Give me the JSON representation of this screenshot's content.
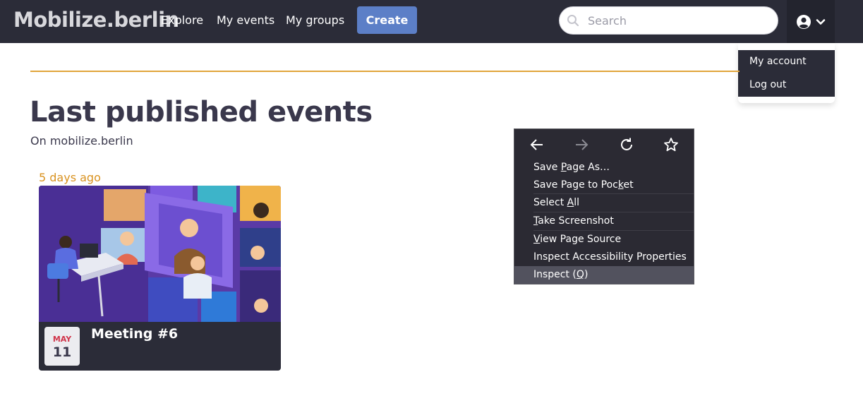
{
  "navbar": {
    "logo": "Mobilize.berlin",
    "links": [
      "Explore",
      "My events",
      "My groups"
    ],
    "create_label": "Create",
    "search_placeholder": "Search",
    "account_icon": "user-circle-icon",
    "chevron_icon": "chevron-down-icon"
  },
  "account_menu": {
    "items": [
      "My account",
      "Log out"
    ]
  },
  "main": {
    "title": "Last published events",
    "subtitle": "On mobilize.berlin"
  },
  "event": {
    "time_ago": "5 days ago",
    "month": "MAY",
    "day": "11",
    "title": "Meeting #6"
  },
  "context_menu": {
    "nav": [
      "back-arrow-icon",
      "forward-arrow-icon",
      "reload-icon",
      "bookmark-star-icon"
    ],
    "items": [
      {
        "pre": "Save ",
        "key": "P",
        "post": "age As…"
      },
      {
        "pre": "Save Page to Poc",
        "key": "k",
        "post": "et"
      },
      {
        "pre": "Select ",
        "key": "A",
        "post": "ll"
      },
      {
        "pre": "",
        "key": "T",
        "post": "ake Screenshot"
      },
      {
        "pre": "",
        "key": "V",
        "post": "iew Page Source"
      },
      {
        "pre": "Inspect Accessibility Properties",
        "key": "",
        "post": ""
      },
      {
        "pre": "Inspect (",
        "key": "Q",
        "post": ")"
      }
    ]
  },
  "colors": {
    "navbar": "#2b2c38",
    "accent_button": "#5c7fc7",
    "rule": "#e1a53a",
    "time_ago": "#d9921f",
    "month": "#d0344a"
  }
}
